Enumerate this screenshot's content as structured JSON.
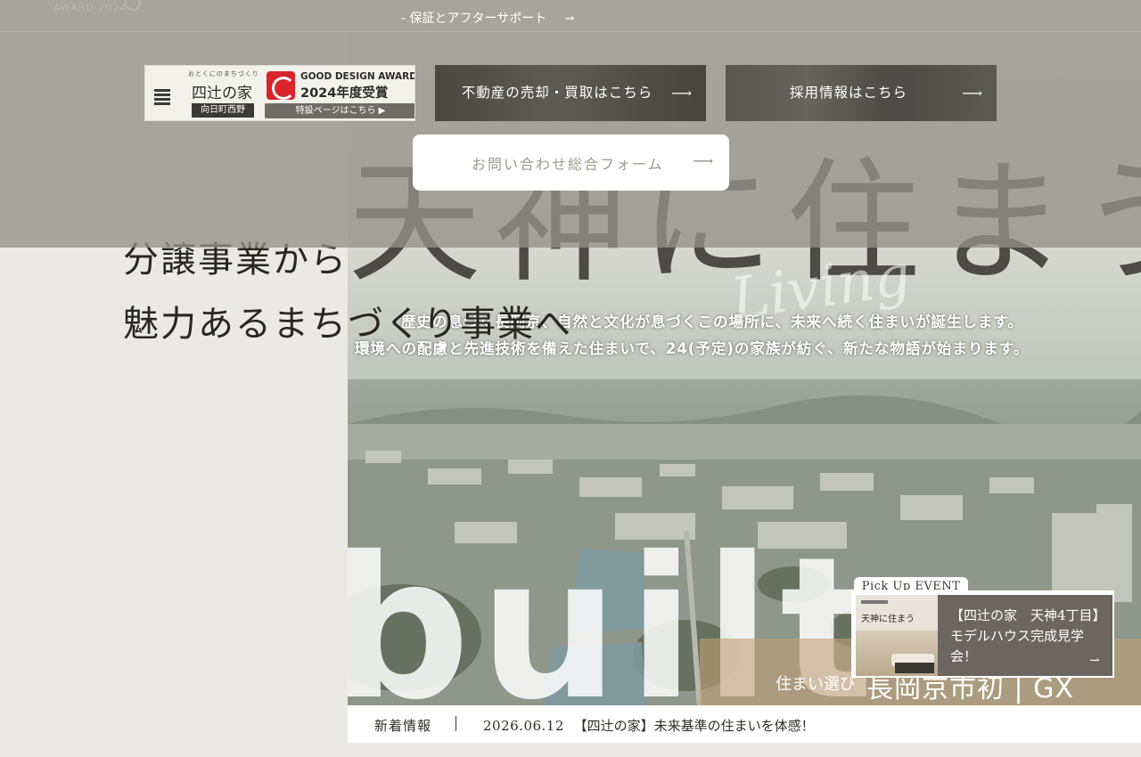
{
  "top_bar": {
    "award_faded": "AWARD 2024",
    "menu_link": "- 保証とアフターサポート"
  },
  "hero": {
    "big_title": "天神に住まう",
    "tagline_line1": "歴史の息づく長岡京、自然と文化が息づくこの場所に、未来へ続く住まいが誕生します。",
    "tagline_line2": "環境への配慮と先進技術を備えた住まいで、24(予定)の家族が紡ぐ、新たな物語が始まります。",
    "bottom_strip_small": "住まい選び",
    "bottom_strip_big": "長岡京市初 | GX"
  },
  "headline": {
    "line1": "分譲事業から",
    "line2": "魅力あるまちづくり事業へ"
  },
  "banners": {
    "award": {
      "caption": "おとくにのまちづくり",
      "brand": "四辻の家",
      "place": "向日町西野",
      "award_name": "GOOD DESIGN AWARD",
      "award_year": "2024年度受賞",
      "special_page": "特設ページはこちら ▶"
    },
    "real_estate": {
      "label": "不動産の売却・買取はこちら"
    },
    "recruit": {
      "label": "採用情報はこちら"
    }
  },
  "contact": {
    "label": "お問い合わせ総合フォーム"
  },
  "pickup": {
    "tab": "Pick Up EVENT",
    "thumb_title": "天神に住まう",
    "title": "【四辻の家　天神4丁目】モデルハウス完成見学会！"
  },
  "news": {
    "label": "新着情報",
    "date": "2026.06.12",
    "text": "【四辻の家】未来基準の住まいを体感！"
  },
  "colors": {
    "overlay": "#949188",
    "page_bg": "#ebe9e5",
    "pickup_body": "#6b6660",
    "text_dark": "#2b2824"
  },
  "icons": {
    "arrow": "arrow-right-icon",
    "award": "good-design-g-icon",
    "house": "house-icon"
  }
}
